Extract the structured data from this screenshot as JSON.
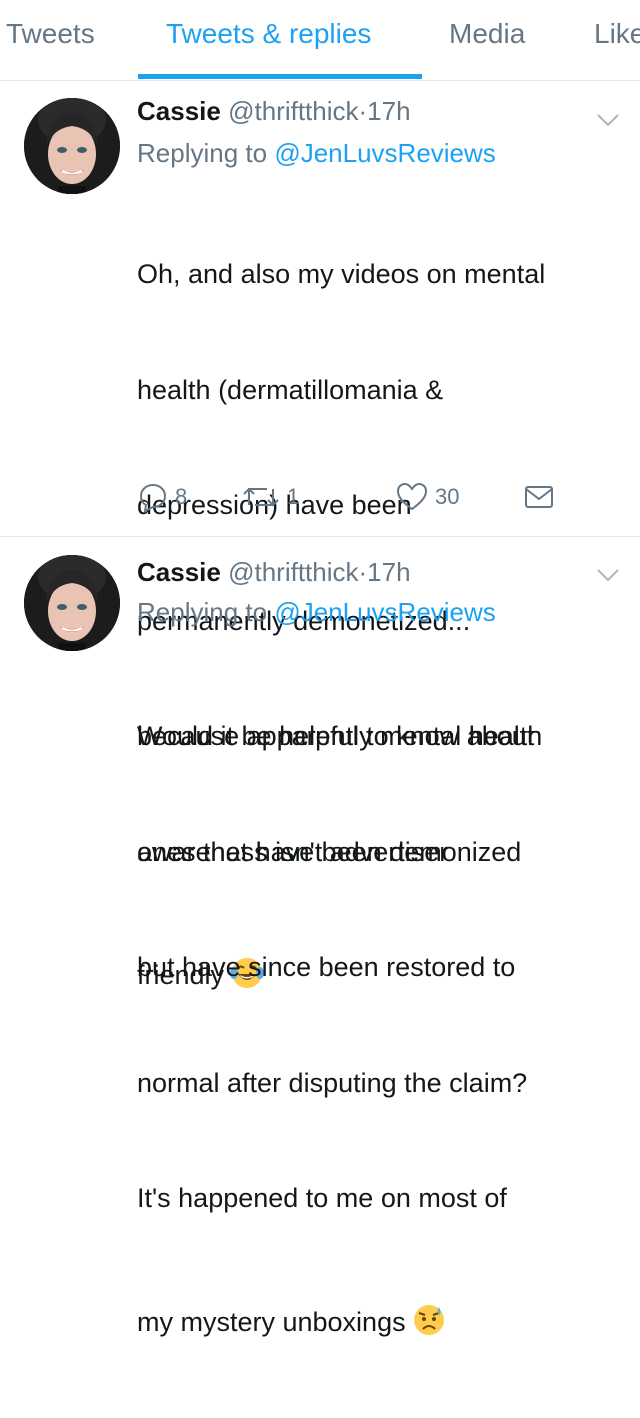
{
  "tabs": [
    {
      "label": "Tweets"
    },
    {
      "label": "Tweets & replies"
    },
    {
      "label": "Media"
    },
    {
      "label": "Like"
    }
  ],
  "tweets": [
    {
      "name": "Cassie",
      "handle": "@thriftthick",
      "dot": "·",
      "time": "17h",
      "replying_prefix": "Replying to ",
      "replying_to": "@JenLuvsReviews",
      "lines": [
        "Oh, and also my videos on mental",
        "health (dermatillomania &",
        "depression) have been",
        "permanently demonetized...",
        "because apparently mental health",
        "awareness isn't advertiser",
        "friendly"
      ],
      "emoji": "tears-of-joy-emoji",
      "replies": "8",
      "retweets": "1",
      "likes": "30"
    },
    {
      "name": "Cassie",
      "handle": "@thriftthick",
      "dot": "·",
      "time": "17h",
      "replying_prefix": "Replying to ",
      "replying_to": "@JenLuvsReviews",
      "lines": [
        "Would it be helpful to know about",
        "ones that have been demonized",
        "but have since been restored to",
        "normal after disputing the claim?",
        "It's happened to me on most of",
        "my mystery unboxings"
      ],
      "emoji": "disappointed-relieved-emoji"
    }
  ],
  "colors": {
    "accent": "#1da1f2",
    "secondary_text": "#657786",
    "primary_text": "#14171a",
    "divider": "#e1e8ed"
  }
}
